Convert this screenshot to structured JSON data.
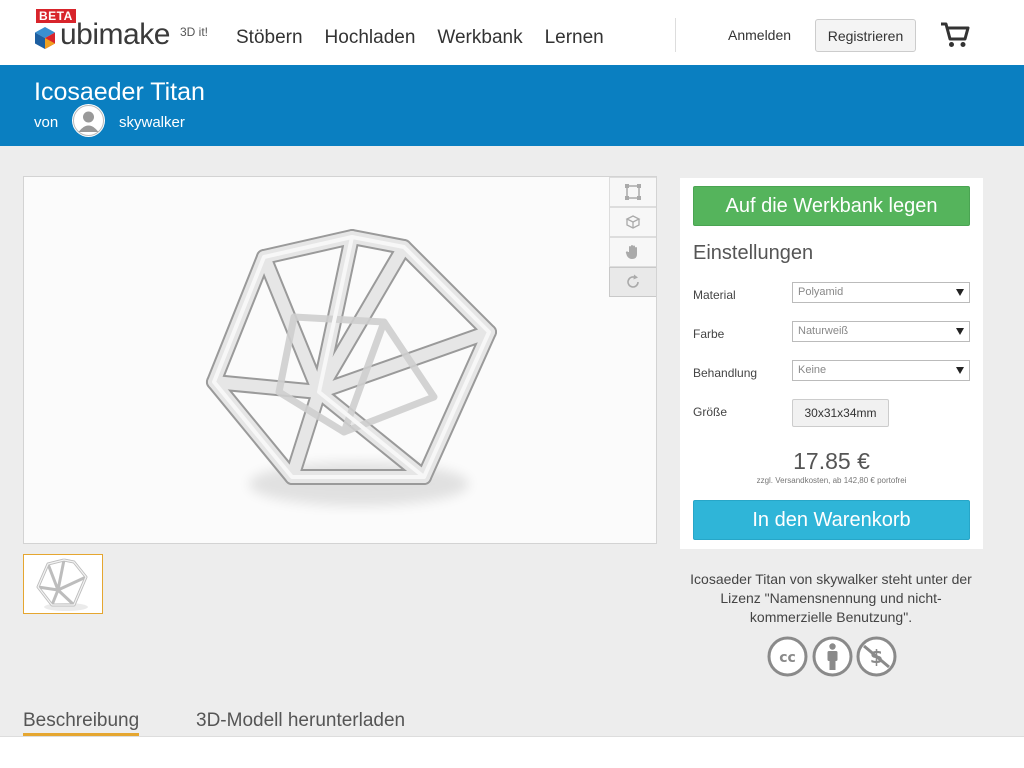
{
  "header": {
    "beta_badge": "BETA",
    "brand": "ubimake",
    "brand_sub": "3D it!",
    "nav": [
      "Stöbern",
      "Hochladen",
      "Werkbank",
      "Lernen"
    ],
    "login": "Anmelden",
    "register": "Registrieren"
  },
  "product": {
    "title": "Icosaeder Titan",
    "by": "von",
    "author": "skywalker"
  },
  "viewer": {
    "tools": [
      "crop-frame-icon",
      "cube-rotate-icon",
      "hand-pan-icon",
      "reset-rotate-icon"
    ]
  },
  "config": {
    "add_workbench": "Auf die Werkbank legen",
    "settings_title": "Einstellungen",
    "material_label": "Material",
    "material_value": "Polyamid",
    "color_label": "Farbe",
    "color_value": "Naturweiß",
    "finish_label": "Behandlung",
    "finish_value": "Keine",
    "size_label": "Größe",
    "size_value": "30x31x34mm",
    "price": "17.85 €",
    "shipping": "zzgl. Versandkosten, ab 142,80 € portofrei",
    "add_cart": "In den Warenkorb"
  },
  "license": {
    "text": "Icosaeder Titan von skywalker steht unter der Lizenz \"Namensnennung und nicht-kommerzielle Benutzung\".",
    "icons": [
      "cc-icon",
      "by-attribution-icon",
      "non-commercial-icon"
    ]
  },
  "tabs": [
    {
      "label": "Beschreibung",
      "active": true
    },
    {
      "label": "3D-Modell herunterladen",
      "active": false
    }
  ],
  "colors": {
    "band_blue": "#0a7fc1",
    "green_button": "#55b45c",
    "blue_button": "#2fb5d8",
    "accent_orange": "#e5a630",
    "beta_red": "#d8242b"
  }
}
